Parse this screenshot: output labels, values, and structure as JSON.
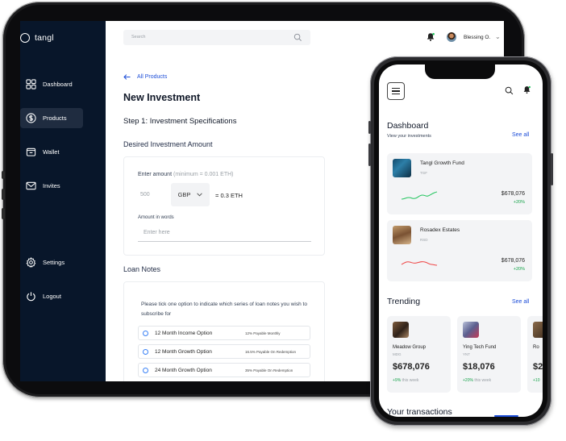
{
  "tablet": {
    "sidebar": {
      "logo": "tangl",
      "items": [
        {
          "label": "Dashboard",
          "icon": "grid-icon"
        },
        {
          "label": "Products",
          "icon": "dollar-circle-icon"
        },
        {
          "label": "Wallet",
          "icon": "wallet-icon"
        },
        {
          "label": "Invites",
          "icon": "mail-icon"
        },
        {
          "label": "Settings",
          "icon": "gear-icon"
        },
        {
          "label": "Logout",
          "icon": "power-icon"
        }
      ]
    },
    "search": {
      "placeholder": "Search"
    },
    "user": {
      "name": "Blessing O."
    },
    "back_link": "All Products",
    "title": "New Investment",
    "step": "Step 1: Investment  Specifications",
    "amount_section": {
      "title": "Desired Investment Amount",
      "enter_label": "Enter amount",
      "minimum": "(minimum = 0.001 ETH)",
      "amount_value": "500",
      "currency": "GBP",
      "conversion": "= 0.3 ETH",
      "words_label": "Amount in words",
      "words_placeholder": "Enter here"
    },
    "notes_section": {
      "title": "Loan Notes",
      "instruction": "Please tick one option to indicate which series of loan notes you wish to subscribe for",
      "options": [
        {
          "name": "12 Month Income Option",
          "rate": "12% Payable Monthly"
        },
        {
          "name": "12 Month Growth Option",
          "rate": "16.5% Payable On Redemption"
        },
        {
          "name": "24 Month Growth Option",
          "rate": "35% Payable On Redemption"
        }
      ]
    }
  },
  "phone": {
    "dashboard": {
      "title": "Dashboard",
      "subtitle": "View your investments",
      "see_all": "See all"
    },
    "funds": [
      {
        "name": "Tangl Growth Fund",
        "ticker": "TGF",
        "price": "$678,076",
        "change": "+20%"
      },
      {
        "name": "Rosadex Estates",
        "ticker": "RSD",
        "price": "$678,076",
        "change": "+20%"
      }
    ],
    "trending": {
      "title": "Trending",
      "see_all": "See all",
      "items": [
        {
          "name": "Meadow Group",
          "ticker": "MDG",
          "price": "$678,076",
          "change": "+9%",
          "period": "this week"
        },
        {
          "name": "Ying Tech Fund",
          "ticker": "YNT",
          "price": "$18,076",
          "change": "+20%",
          "period": "this week"
        },
        {
          "name": "Ro",
          "ticker": "",
          "price": "$2",
          "change": "+10",
          "period": ""
        }
      ]
    },
    "transactions_title": "Your transactions"
  },
  "colors": {
    "sidebar_bg": "#08162a",
    "accent": "#1d4ed8",
    "positive": "#16a34a",
    "spark_green": "#22c55e",
    "spark_red": "#ef4444"
  }
}
